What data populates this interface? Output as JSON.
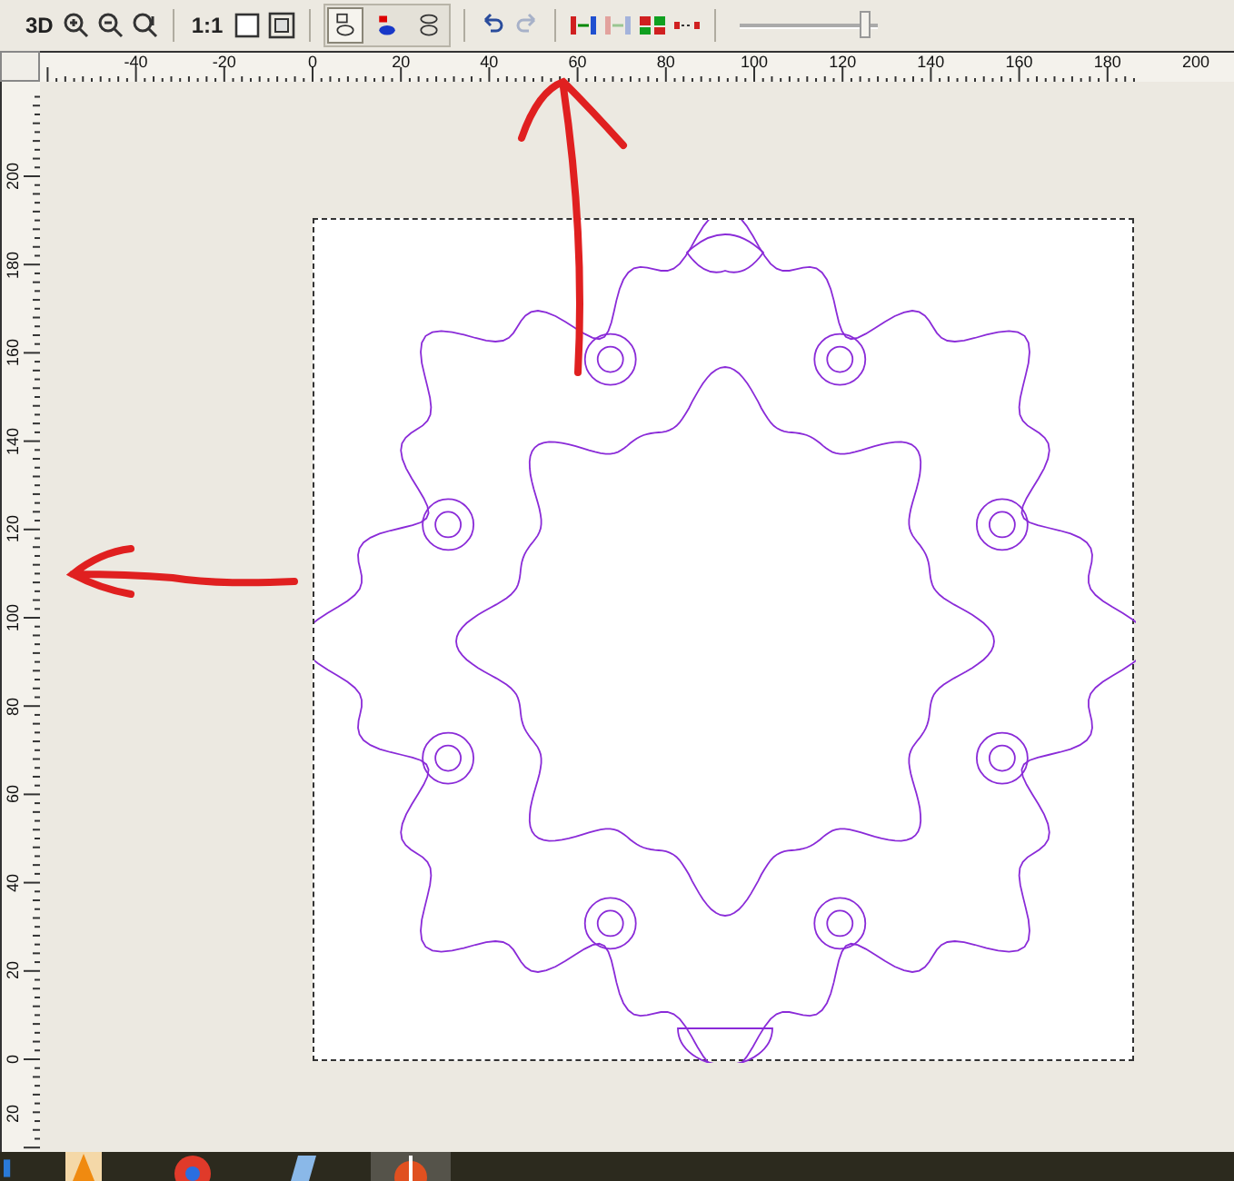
{
  "toolbar": {
    "zoom_tools": [
      {
        "kind": "text",
        "label": "3D"
      },
      {
        "kind": "zoom-in"
      },
      {
        "kind": "zoom-out"
      },
      {
        "kind": "zoom-fit"
      }
    ],
    "page_tools": [
      {
        "kind": "text",
        "label": "1:1"
      },
      {
        "kind": "page"
      },
      {
        "kind": "frame"
      }
    ],
    "view_modes": [
      {
        "kind": "top",
        "selected": true
      },
      {
        "kind": "middle",
        "selected": false
      },
      {
        "kind": "bottom",
        "selected": false
      }
    ],
    "history": [
      {
        "kind": "undo",
        "disabled": false
      },
      {
        "kind": "redo",
        "disabled": true
      }
    ],
    "node_tools": [
      {
        "kind": "split",
        "disabled": false
      },
      {
        "kind": "join",
        "disabled": true
      },
      {
        "kind": "align",
        "disabled": false
      },
      {
        "kind": "dots",
        "disabled": false
      }
    ],
    "slider": {
      "level": 0.97
    }
  },
  "ruler_top": {
    "labels": [
      "-40",
      "-20",
      "0",
      "20",
      "40",
      "60",
      "80",
      "100",
      "120",
      "140",
      "160",
      "180",
      "200"
    ]
  },
  "ruler_left": {
    "labels": [
      "200",
      "180",
      "160",
      "140",
      "120",
      "100",
      "80",
      "60",
      "40",
      "20",
      "0",
      "20"
    ]
  },
  "taskbar": {
    "apps": [
      {
        "kind": "cone",
        "selected": false
      },
      {
        "kind": "browser",
        "selected": false
      },
      {
        "kind": "notes",
        "selected": false
      },
      {
        "kind": "cutter",
        "selected": true
      }
    ]
  }
}
